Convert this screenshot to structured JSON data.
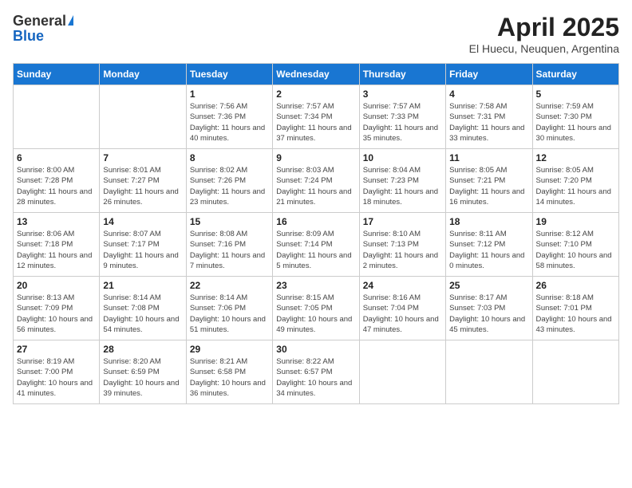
{
  "logo": {
    "general": "General",
    "blue": "Blue"
  },
  "header": {
    "title": "April 2025",
    "location": "El Huecu, Neuquen, Argentina"
  },
  "days_of_week": [
    "Sunday",
    "Monday",
    "Tuesday",
    "Wednesday",
    "Thursday",
    "Friday",
    "Saturday"
  ],
  "weeks": [
    [
      {
        "day": "",
        "info": ""
      },
      {
        "day": "",
        "info": ""
      },
      {
        "day": "1",
        "info": "Sunrise: 7:56 AM\nSunset: 7:36 PM\nDaylight: 11 hours and 40 minutes."
      },
      {
        "day": "2",
        "info": "Sunrise: 7:57 AM\nSunset: 7:34 PM\nDaylight: 11 hours and 37 minutes."
      },
      {
        "day": "3",
        "info": "Sunrise: 7:57 AM\nSunset: 7:33 PM\nDaylight: 11 hours and 35 minutes."
      },
      {
        "day": "4",
        "info": "Sunrise: 7:58 AM\nSunset: 7:31 PM\nDaylight: 11 hours and 33 minutes."
      },
      {
        "day": "5",
        "info": "Sunrise: 7:59 AM\nSunset: 7:30 PM\nDaylight: 11 hours and 30 minutes."
      }
    ],
    [
      {
        "day": "6",
        "info": "Sunrise: 8:00 AM\nSunset: 7:28 PM\nDaylight: 11 hours and 28 minutes."
      },
      {
        "day": "7",
        "info": "Sunrise: 8:01 AM\nSunset: 7:27 PM\nDaylight: 11 hours and 26 minutes."
      },
      {
        "day": "8",
        "info": "Sunrise: 8:02 AM\nSunset: 7:26 PM\nDaylight: 11 hours and 23 minutes."
      },
      {
        "day": "9",
        "info": "Sunrise: 8:03 AM\nSunset: 7:24 PM\nDaylight: 11 hours and 21 minutes."
      },
      {
        "day": "10",
        "info": "Sunrise: 8:04 AM\nSunset: 7:23 PM\nDaylight: 11 hours and 18 minutes."
      },
      {
        "day": "11",
        "info": "Sunrise: 8:05 AM\nSunset: 7:21 PM\nDaylight: 11 hours and 16 minutes."
      },
      {
        "day": "12",
        "info": "Sunrise: 8:05 AM\nSunset: 7:20 PM\nDaylight: 11 hours and 14 minutes."
      }
    ],
    [
      {
        "day": "13",
        "info": "Sunrise: 8:06 AM\nSunset: 7:18 PM\nDaylight: 11 hours and 12 minutes."
      },
      {
        "day": "14",
        "info": "Sunrise: 8:07 AM\nSunset: 7:17 PM\nDaylight: 11 hours and 9 minutes."
      },
      {
        "day": "15",
        "info": "Sunrise: 8:08 AM\nSunset: 7:16 PM\nDaylight: 11 hours and 7 minutes."
      },
      {
        "day": "16",
        "info": "Sunrise: 8:09 AM\nSunset: 7:14 PM\nDaylight: 11 hours and 5 minutes."
      },
      {
        "day": "17",
        "info": "Sunrise: 8:10 AM\nSunset: 7:13 PM\nDaylight: 11 hours and 2 minutes."
      },
      {
        "day": "18",
        "info": "Sunrise: 8:11 AM\nSunset: 7:12 PM\nDaylight: 11 hours and 0 minutes."
      },
      {
        "day": "19",
        "info": "Sunrise: 8:12 AM\nSunset: 7:10 PM\nDaylight: 10 hours and 58 minutes."
      }
    ],
    [
      {
        "day": "20",
        "info": "Sunrise: 8:13 AM\nSunset: 7:09 PM\nDaylight: 10 hours and 56 minutes."
      },
      {
        "day": "21",
        "info": "Sunrise: 8:14 AM\nSunset: 7:08 PM\nDaylight: 10 hours and 54 minutes."
      },
      {
        "day": "22",
        "info": "Sunrise: 8:14 AM\nSunset: 7:06 PM\nDaylight: 10 hours and 51 minutes."
      },
      {
        "day": "23",
        "info": "Sunrise: 8:15 AM\nSunset: 7:05 PM\nDaylight: 10 hours and 49 minutes."
      },
      {
        "day": "24",
        "info": "Sunrise: 8:16 AM\nSunset: 7:04 PM\nDaylight: 10 hours and 47 minutes."
      },
      {
        "day": "25",
        "info": "Sunrise: 8:17 AM\nSunset: 7:03 PM\nDaylight: 10 hours and 45 minutes."
      },
      {
        "day": "26",
        "info": "Sunrise: 8:18 AM\nSunset: 7:01 PM\nDaylight: 10 hours and 43 minutes."
      }
    ],
    [
      {
        "day": "27",
        "info": "Sunrise: 8:19 AM\nSunset: 7:00 PM\nDaylight: 10 hours and 41 minutes."
      },
      {
        "day": "28",
        "info": "Sunrise: 8:20 AM\nSunset: 6:59 PM\nDaylight: 10 hours and 39 minutes."
      },
      {
        "day": "29",
        "info": "Sunrise: 8:21 AM\nSunset: 6:58 PM\nDaylight: 10 hours and 36 minutes."
      },
      {
        "day": "30",
        "info": "Sunrise: 8:22 AM\nSunset: 6:57 PM\nDaylight: 10 hours and 34 minutes."
      },
      {
        "day": "",
        "info": ""
      },
      {
        "day": "",
        "info": ""
      },
      {
        "day": "",
        "info": ""
      }
    ]
  ]
}
